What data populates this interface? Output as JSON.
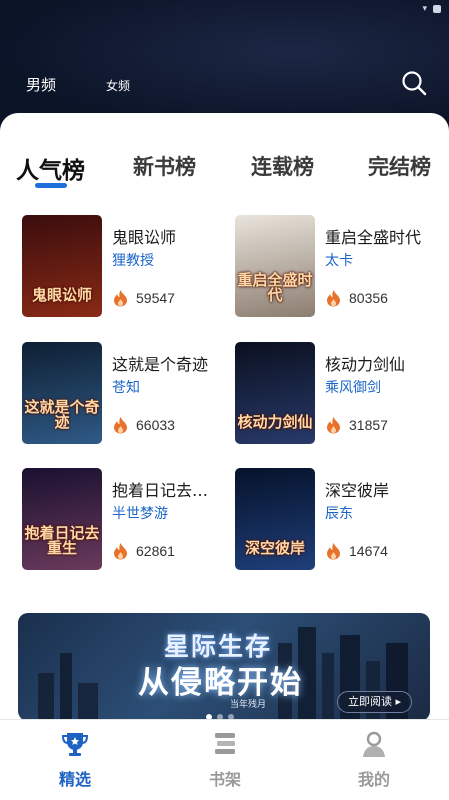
{
  "header": {
    "gender_tabs": [
      {
        "label": "男频",
        "active": true
      },
      {
        "label": "女频",
        "active": false
      }
    ]
  },
  "rank_tabs": [
    {
      "label": "人气榜",
      "active": true
    },
    {
      "label": "新书榜",
      "active": false
    },
    {
      "label": "连载榜",
      "active": false
    },
    {
      "label": "完结榜",
      "active": false
    }
  ],
  "books": [
    {
      "title": "鬼眼讼师",
      "author": "狸教授",
      "heat": "59547",
      "cover_text": "鬼眼讼师",
      "cover_colors": [
        "#3a0d0d",
        "#8a2a16"
      ]
    },
    {
      "title": "重启全盛时代",
      "author": "太卡",
      "heat": "80356",
      "cover_text": "重启全盛时代",
      "cover_colors": [
        "#e9e4dc",
        "#8c7d70"
      ]
    },
    {
      "title": "这就是个奇迹",
      "author": "苍知",
      "heat": "66033",
      "cover_text": "这就是个奇迹",
      "cover_colors": [
        "#0e1f33",
        "#2f5a86"
      ]
    },
    {
      "title": "核动力剑仙",
      "author": "乘风御剑",
      "heat": "31857",
      "cover_text": "核动力剑仙",
      "cover_colors": [
        "#0b1020",
        "#283a6a"
      ]
    },
    {
      "title": "抱着日记去…",
      "author": "半世梦游",
      "heat": "62861",
      "cover_text": "抱着日记去重生",
      "cover_colors": [
        "#1a1030",
        "#6a3a5c"
      ]
    },
    {
      "title": "深空彼岸",
      "author": "辰东",
      "heat": "14674",
      "cover_text": "深空彼岸",
      "cover_colors": [
        "#06122a",
        "#1f3f7a"
      ]
    }
  ],
  "banner": {
    "title_line1": "星际生存",
    "title_line2": "从侵略开始",
    "author": "当年残月",
    "button_label": "立即阅读 ▸"
  },
  "bottom_nav": [
    {
      "label": "精选",
      "icon": "trophy-icon",
      "active": true
    },
    {
      "label": "书架",
      "icon": "bookshelf-icon",
      "active": false
    },
    {
      "label": "我的",
      "icon": "profile-icon",
      "active": false
    }
  ],
  "colors": {
    "accent": "#1e63c4",
    "author": "#1d67c9",
    "heat": "#e8722c",
    "header_bg": "#0c1428"
  }
}
